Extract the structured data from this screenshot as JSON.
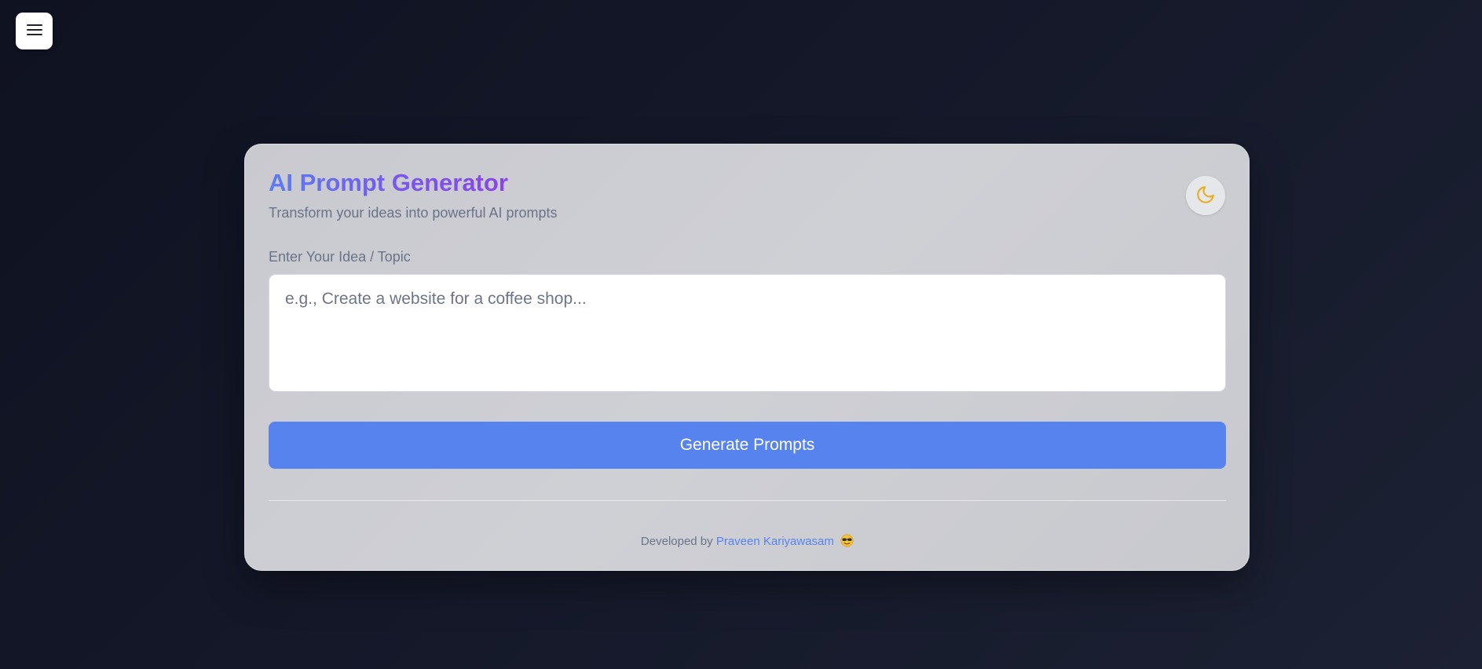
{
  "menu": {
    "icon": "hamburger-menu-icon"
  },
  "header": {
    "title": "AI Prompt Generator",
    "subtitle": "Transform your ideas into powerful AI prompts",
    "theme_toggle_icon": "moon-icon"
  },
  "form": {
    "label": "Enter Your Idea / Topic",
    "value": "",
    "placeholder": "e.g., Create a website for a coffee shop...",
    "button_label": "Generate Prompts"
  },
  "footer": {
    "prefix": "Developed by",
    "author": "Praveen Kariyawasam",
    "emoji_icon": "sunglasses-face-icon"
  },
  "colors": {
    "accent": "#5683ee",
    "title_gradient_start": "#5b7cf0",
    "title_gradient_end": "#8a45e6",
    "moon": "#e8b021",
    "background": "#141829"
  }
}
